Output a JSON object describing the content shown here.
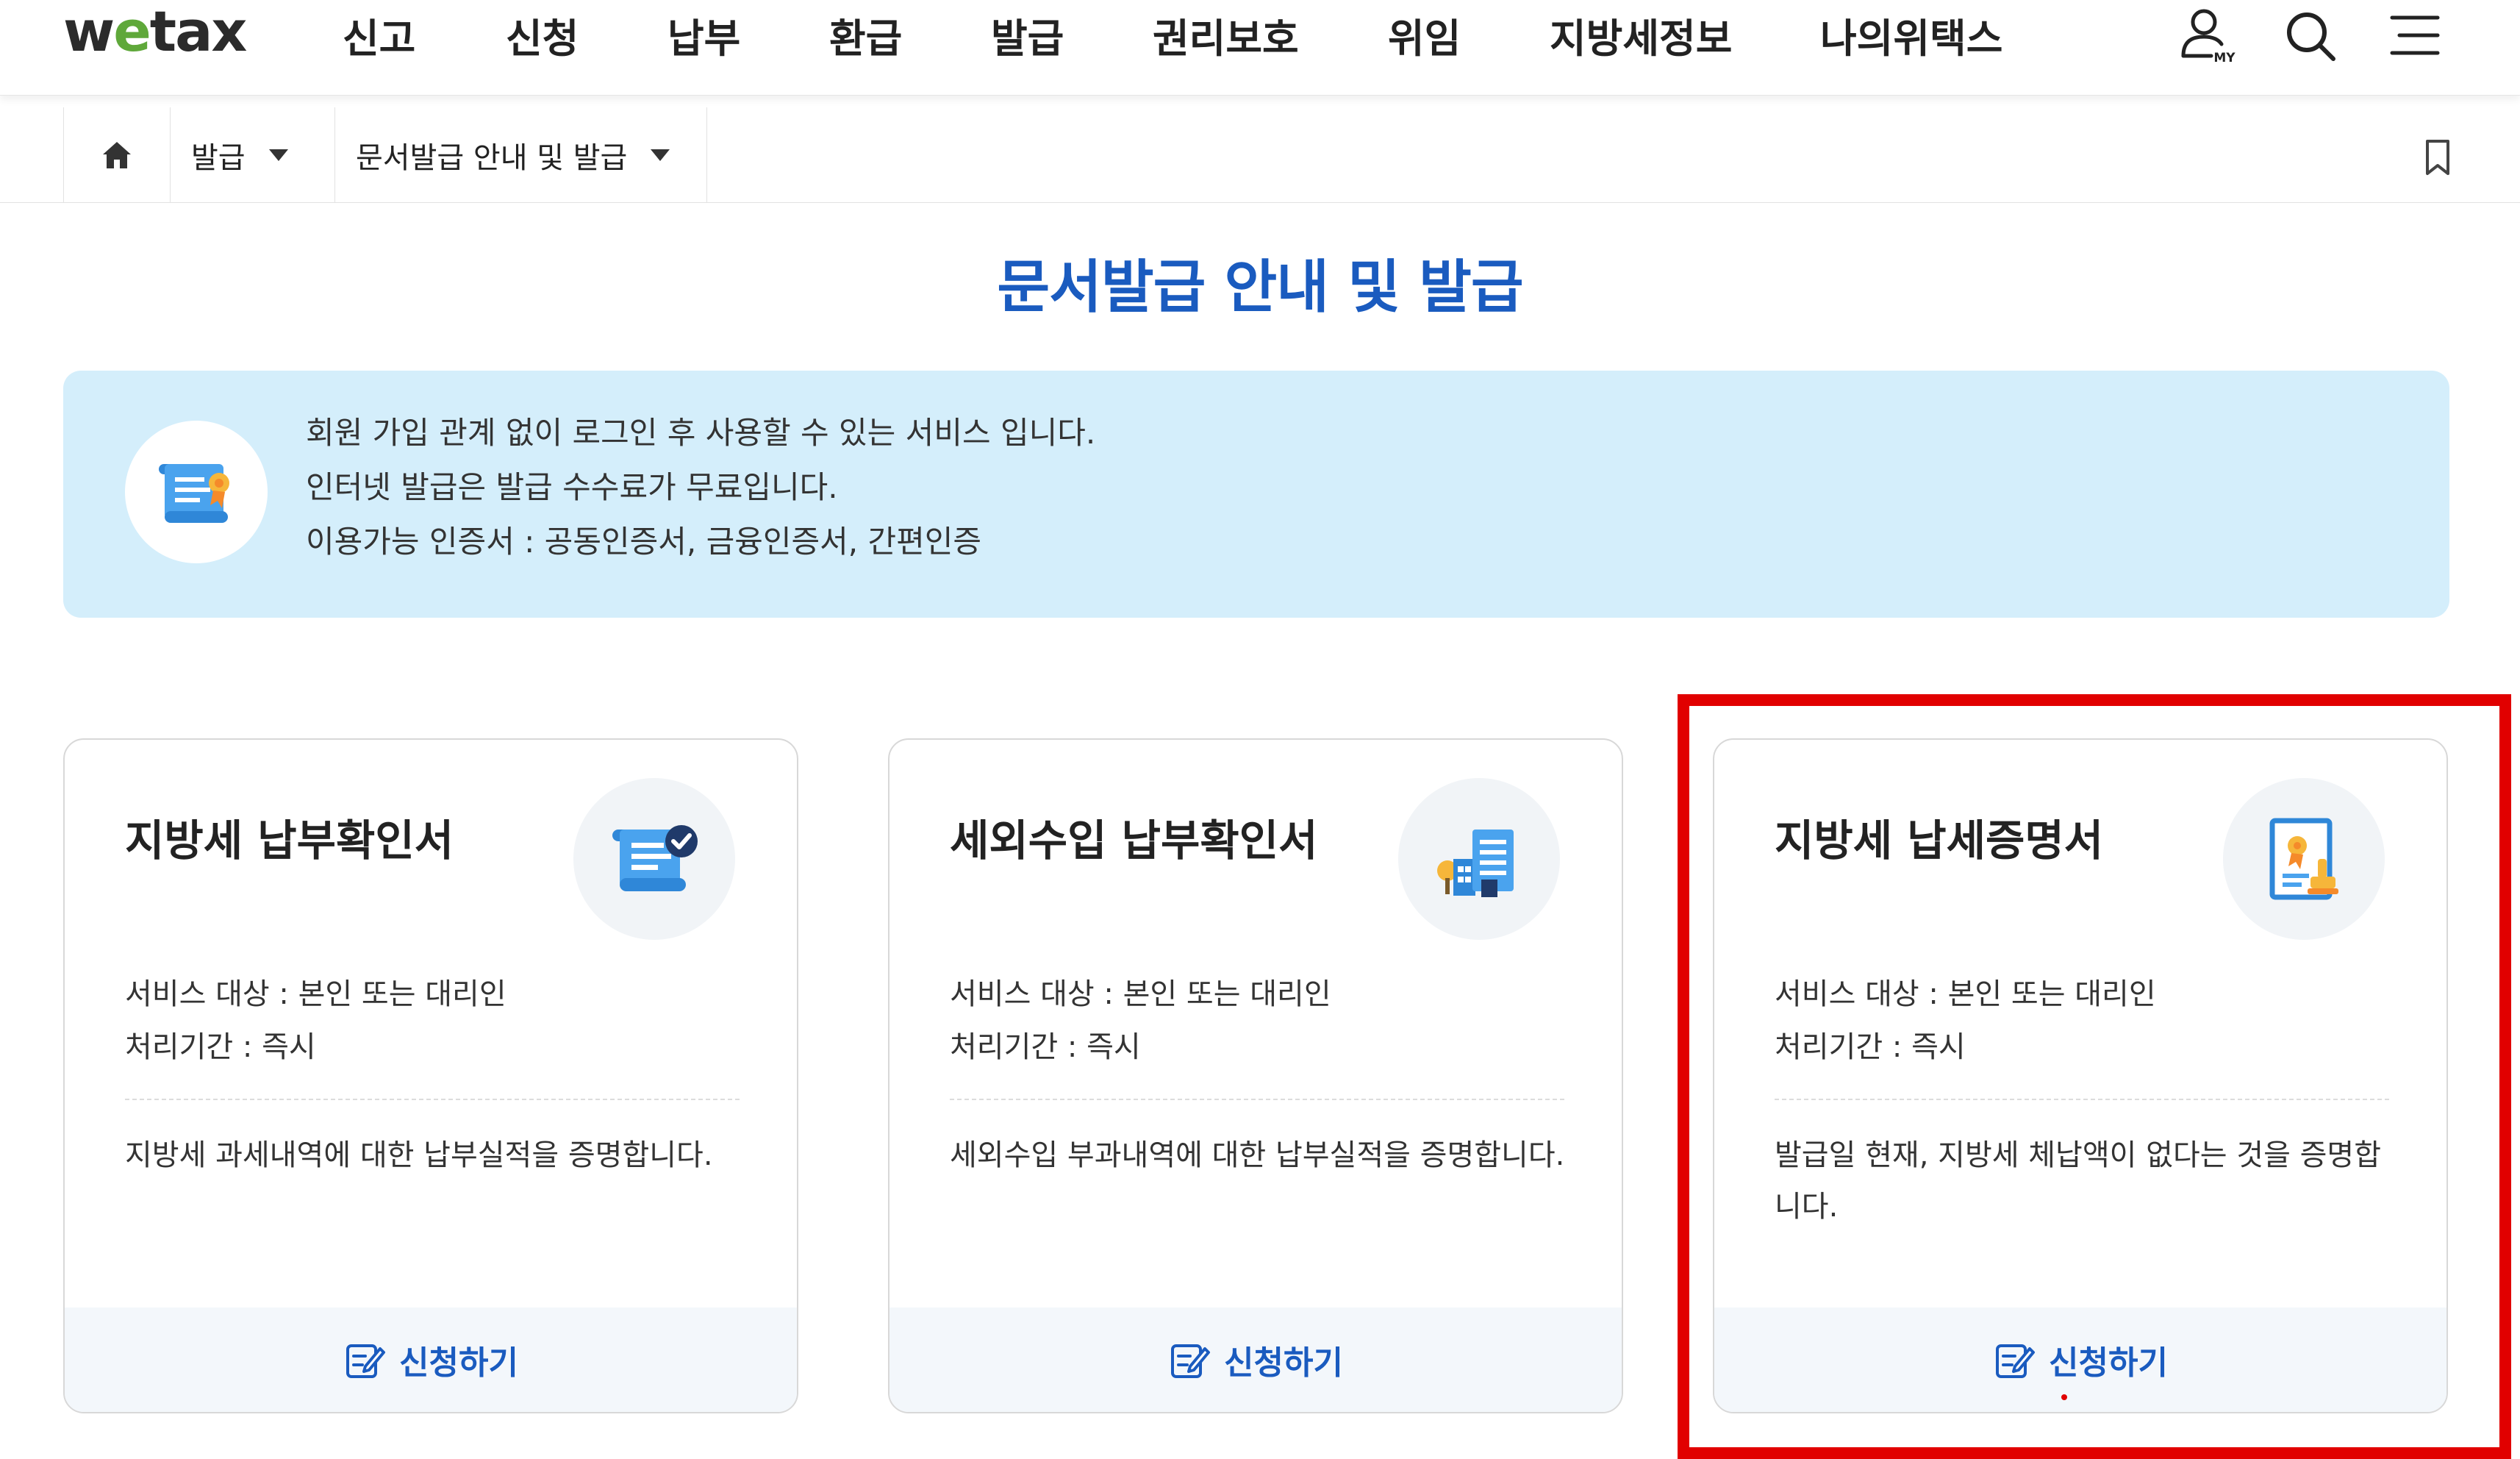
{
  "header": {
    "logo": {
      "prefix": "w",
      "e": "e",
      "suffix": "tax"
    },
    "nav": [
      "신고",
      "신청",
      "납부",
      "환급",
      "발급",
      "권리보호",
      "위임",
      "지방세정보",
      "나의위택스"
    ],
    "icons": [
      "my-account-icon",
      "search-icon",
      "menu-icon"
    ],
    "my_label": "MY"
  },
  "breadcrumb": {
    "home_icon": "home-icon",
    "level1": "발급",
    "level2": "문서발급 안내 및 발급",
    "bookmark_icon": "bookmark-icon"
  },
  "page": {
    "title": "문서발급 안내 및 발급"
  },
  "info": {
    "icon": "certificate-scroll-icon",
    "lines": [
      "회원 가입 관계 없이 로그인 후 사용할 수 있는 서비스 입니다.",
      "인터넷 발급은 발급 수수료가 무료입니다.",
      "이용가능 인증서 : 공동인증서, 금융인증서, 간편인증"
    ]
  },
  "cards": [
    {
      "title": "지방세 납부확인서",
      "icon": "document-check-icon",
      "target": "서비스 대상 : 본인 또는 대리인",
      "period": "처리기간 : 즉시",
      "desc": "지방세 과세내역에 대한 납부실적을 증명합니다.",
      "action": "신청하기"
    },
    {
      "title": "세외수입 납부확인서",
      "icon": "buildings-document-icon",
      "target": "서비스 대상 : 본인 또는 대리인",
      "period": "처리기간 : 즉시",
      "desc": "세외수입 부과내역에 대한 납부실적을 증명합니다.",
      "action": "신청하기"
    },
    {
      "title": "지방세 납세증명서",
      "icon": "certificate-stamp-icon",
      "target": "서비스 대상 : 본인 또는 대리인",
      "period": "처리기간 : 즉시",
      "desc": "발급일 현재, 지방세 체납액이 없다는 것을 증명합니다.",
      "action": "신청하기"
    }
  ],
  "colors": {
    "accent": "#1a5bbf",
    "info_bg": "#d4eefb",
    "highlight": "#e10000",
    "logo_e": "#5fa83a"
  }
}
